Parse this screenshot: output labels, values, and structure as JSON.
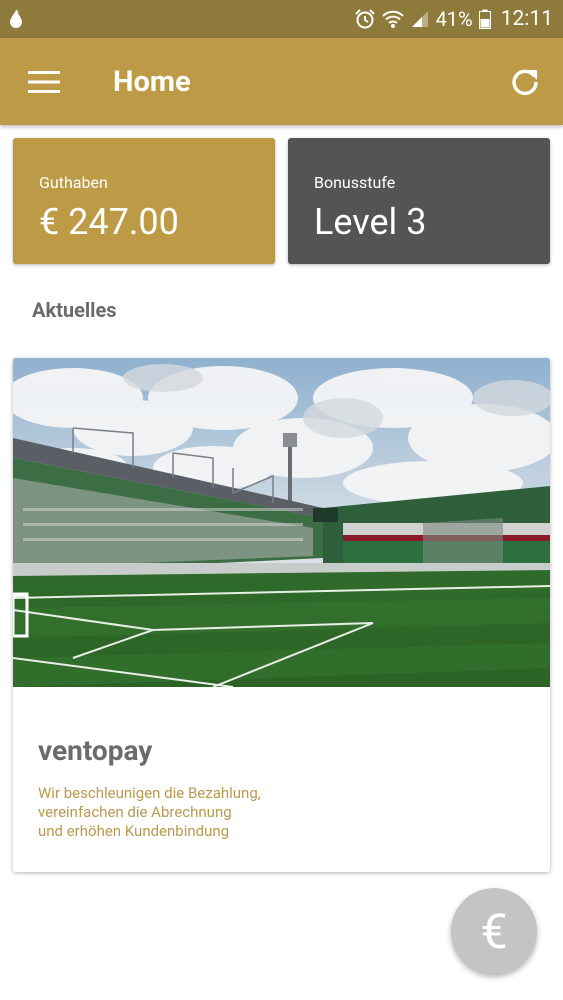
{
  "status_bar": {
    "battery_percent": "41%",
    "time": "12:11"
  },
  "app_bar": {
    "title": "Home"
  },
  "balance_card": {
    "label": "Guthaben",
    "value": "€ 247.00"
  },
  "level_card": {
    "label": "Bonusstufe",
    "value": "Level 3"
  },
  "news_section": {
    "title": "Aktuelles",
    "items": [
      {
        "title": "ventopay",
        "lines": [
          "Wir beschleunigen die Bezahlung,",
          "vereinfachen die Abrechnung",
          "und erhöhen Kundenbindung"
        ]
      }
    ]
  },
  "fab": {
    "icon_glyph": "€",
    "icon": "euro-icon"
  },
  "colors": {
    "status_bar": "#8e7a3a",
    "primary": "#bd9b46",
    "level_card": "#545454",
    "fab": "#c4c4c4",
    "news_text": "#b99a4e"
  }
}
